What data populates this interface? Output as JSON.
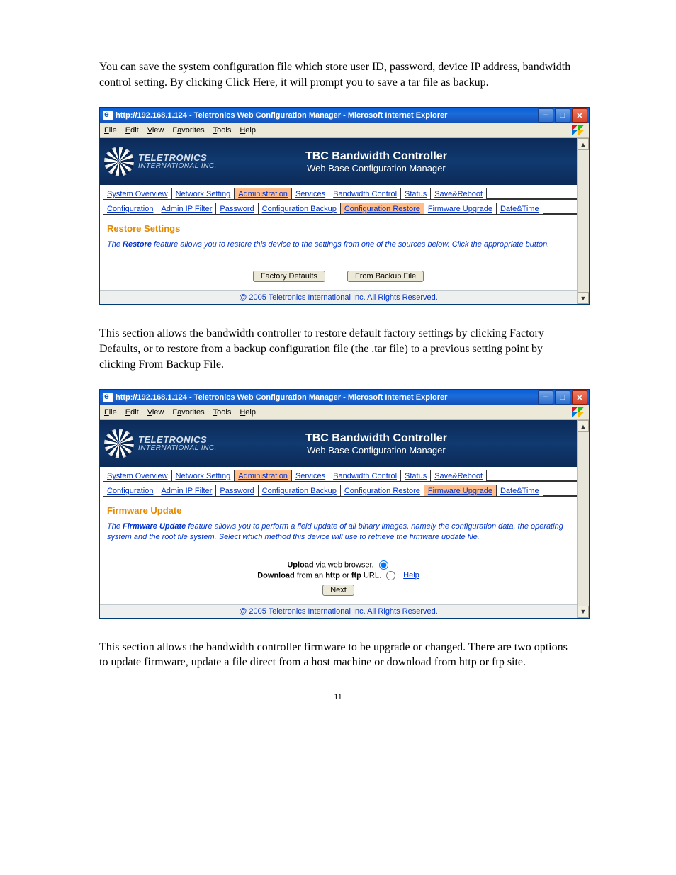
{
  "para1": "You can save the system configuration file which store user ID, password, device IP address, bandwidth control setting.  By clicking Click Here, it will prompt you to save a tar file as backup.",
  "para2": "This section allows the bandwidth controller to restore default factory settings by clicking Factory Defaults, or to restore from a backup configuration file (the .tar file) to a previous setting point by clicking From Backup File.",
  "para3": "This section allows the bandwidth controller firmware to be upgrade or changed.  There are two options to update firmware, update a file direct from a host machine or download from http or ftp site.",
  "page_number": "11",
  "window": {
    "title": "http://192.168.1.124 - Teletronics Web Configuration Manager - Microsoft Internet Explorer",
    "menus": [
      "File",
      "Edit",
      "View",
      "Favorites",
      "Tools",
      "Help"
    ]
  },
  "banner": {
    "logo1": "TELETRONICS",
    "logo2": "INTERNATIONAL INC.",
    "h1": "TBC Bandwidth Controller",
    "h2": "Web Base Configuration Manager"
  },
  "tabs": [
    "System Overview",
    "Network Setting",
    "Administration",
    "Services",
    "Bandwidth Control",
    "Status",
    "Save&Reboot"
  ],
  "subtabs": [
    "Configuration",
    "Admin IP Filter",
    "Password",
    "Configuration Backup",
    "Configuration Restore",
    "Firmware Upgrade",
    "Date&Time"
  ],
  "footer": "@ 2005 Teletronics International Inc. All Rights Reserved.",
  "screenshot1": {
    "active_tab": "Administration",
    "active_subtab": "Configuration Restore",
    "section_title": "Restore Settings",
    "desc_prefix": "The ",
    "desc_bold": "Restore",
    "desc_rest": " feature allows you to restore this device to the settings from one of the sources below. Click the appropriate button.",
    "btn1": "Factory Defaults",
    "btn2": "From Backup File"
  },
  "screenshot2": {
    "active_tab": "Administration",
    "active_subtab": "Firmware Upgrade",
    "section_title": "Firmware Update",
    "desc_prefix": "The ",
    "desc_bold": "Firmware Update",
    "desc_rest": " feature allows you to perform a field update of all binary images, namely the configuration data, the operating system and the root file system. Select which method this device will use to retrieve the firmware update file.",
    "row1_bold": "Upload",
    "row1_rest": " via web browser.",
    "row2_bold": "Download",
    "row2_mid": " from an ",
    "row2_bold2": "http",
    "row2_or": " or ",
    "row2_bold3": "ftp",
    "row2_end": " URL.",
    "help": "Help",
    "next_btn": "Next"
  }
}
